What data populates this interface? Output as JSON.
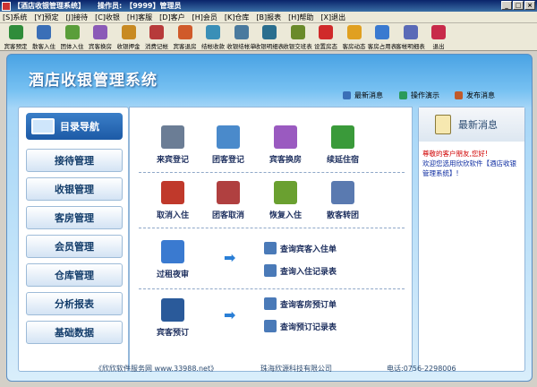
{
  "window": {
    "title": "【酒店收银管理系统】",
    "operator_label": "操作员:",
    "operator_value": "【9999】管理员"
  },
  "menu": [
    {
      "key": "[S]",
      "label": "系统"
    },
    {
      "key": "[Y]",
      "label": "预定"
    },
    {
      "key": "[J]",
      "label": "接待"
    },
    {
      "key": "[C]",
      "label": "收银"
    },
    {
      "key": "[H]",
      "label": "客服"
    },
    {
      "key": "[D]",
      "label": "客户"
    },
    {
      "key": "[H]",
      "label": "会员"
    },
    {
      "key": "[K]",
      "label": "仓库"
    },
    {
      "key": "[B]",
      "label": "报表"
    },
    {
      "key": "[H]",
      "label": "帮助"
    },
    {
      "key": "[X]",
      "label": "退出"
    }
  ],
  "toolbar": [
    {
      "label": "宾客预定",
      "icon": "reservation-icon",
      "color": "#2f8c3a"
    },
    {
      "label": "散客入住",
      "icon": "checkin-icon",
      "color": "#3a6fb7"
    },
    {
      "label": "团体入住",
      "icon": "group-checkin-icon",
      "color": "#5a9e3a"
    },
    {
      "label": "宾客换房",
      "icon": "room-change-icon",
      "color": "#8b5ab7"
    },
    {
      "label": "收银押金",
      "icon": "deposit-icon",
      "color": "#c88a22"
    },
    {
      "label": "消费记帐",
      "icon": "consumption-icon",
      "color": "#b73a3a"
    },
    {
      "label": "宾客退房",
      "icon": "checkout-icon",
      "color": "#d05a2a"
    },
    {
      "label": "结帐收款",
      "icon": "payment-icon",
      "color": "#3a8fb7"
    },
    {
      "label": "收银结帐单",
      "icon": "bill-icon",
      "color": "#4a7a9e"
    },
    {
      "label": "收银明细表",
      "icon": "detail-report-icon",
      "color": "#2a6e8e"
    },
    {
      "label": "收银交班表",
      "icon": "shift-report-icon",
      "color": "#6a8a2a"
    },
    {
      "label": "设置房态",
      "icon": "room-status-icon",
      "color": "#d02a2a"
    },
    {
      "label": "客房动态",
      "icon": "room-dynamic-icon",
      "color": "#e0a020"
    },
    {
      "label": "客房占用表",
      "icon": "occupancy-icon",
      "color": "#3a7ad0"
    },
    {
      "label": "客帐明细表",
      "icon": "account-report-icon",
      "color": "#5a6ab7"
    },
    {
      "label": "退出",
      "icon": "exit-icon",
      "color": "#c82a4a"
    }
  ],
  "header": {
    "app_title": "酒店收银管理系统",
    "links": [
      {
        "label": "最新消息",
        "icon": "news-icon",
        "color": "#3a6fb7"
      },
      {
        "label": "操作演示",
        "icon": "demo-icon",
        "color": "#2a9a5a"
      },
      {
        "label": "发布消息",
        "icon": "publish-icon",
        "color": "#c05a2a"
      }
    ]
  },
  "nav": {
    "title": "目录导航",
    "items": [
      "接待管理",
      "收银管理",
      "客房管理",
      "会员管理",
      "仓库管理",
      "分析报表",
      "基础数据"
    ]
  },
  "functions": {
    "row1": [
      {
        "label": "来宾登记",
        "icon": "guest-register-icon",
        "color": "#6b7d95"
      },
      {
        "label": "团客登记",
        "icon": "group-register-icon",
        "color": "#4a8acb"
      },
      {
        "label": "宾客换房",
        "icon": "room-change-icon",
        "color": "#9a5ac0"
      },
      {
        "label": "续延住宿",
        "icon": "extend-stay-icon",
        "color": "#3a9a3a"
      }
    ],
    "row2": [
      {
        "label": "取消入住",
        "icon": "cancel-checkin-icon",
        "color": "#c0392b"
      },
      {
        "label": "团客取消",
        "icon": "cancel-group-icon",
        "color": "#b04040"
      },
      {
        "label": "恢复入住",
        "icon": "restore-checkin-icon",
        "color": "#6aa030"
      },
      {
        "label": "散客转团",
        "icon": "transfer-group-icon",
        "color": "#5a7ab0"
      }
    ],
    "night_audit": {
      "label": "过租夜审",
      "icon": "night-audit-icon",
      "color": "#3a7ad0"
    },
    "night_queries": [
      {
        "label": "查询宾客入住单",
        "icon": "query-icon"
      },
      {
        "label": "查询入住记录表",
        "icon": "query-icon"
      }
    ],
    "booking": {
      "label": "宾客预订",
      "icon": "booking-icon",
      "color": "#2a5a9a"
    },
    "booking_queries": [
      {
        "label": "查询客房预订单",
        "icon": "query-icon"
      },
      {
        "label": "查询预订记录表",
        "icon": "query-icon"
      }
    ]
  },
  "news": {
    "title": "最新消息",
    "line1": "尊敬的客户朋友,您好!",
    "line2": "欢迎您选用欣欣软件【酒店收银管理系统】!"
  },
  "footer": {
    "left": "《欣欣软件服务网 www.33988.net》",
    "center": "珠海欣源科技有限公司",
    "right": "电话:0756-2298006"
  }
}
